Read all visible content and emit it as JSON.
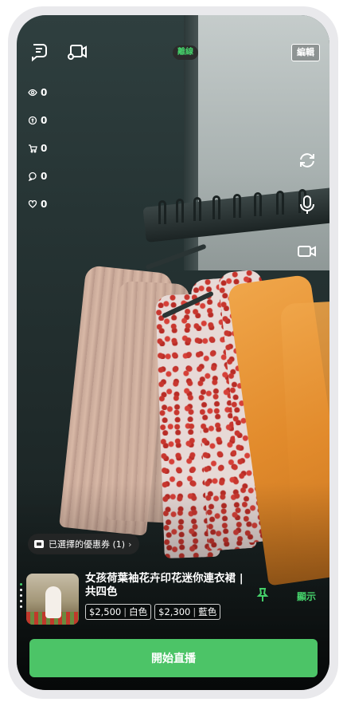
{
  "top_bar": {
    "live_badge": "離線",
    "edit_label": "編輯"
  },
  "stats": [
    {
      "icon": "eye-icon",
      "value": "0"
    },
    {
      "icon": "coin-icon",
      "value": "0"
    },
    {
      "icon": "cart-icon",
      "value": "0"
    },
    {
      "icon": "comment-icon",
      "value": "0"
    },
    {
      "icon": "heart-icon",
      "value": "0"
    }
  ],
  "coupon": {
    "label": "已選擇的優惠券 (1)",
    "chevron": "›"
  },
  "product": {
    "name": "女孩荷葉袖花卉印花迷你連衣裙 | 共四色",
    "prices": [
      {
        "price": "$2,500",
        "color": "白色"
      },
      {
        "price": "$2,300",
        "color": "藍色"
      }
    ],
    "show_label": "顯示"
  },
  "start_button": "開始直播",
  "colors": {
    "accent": "#4cc467",
    "live_text": "#45d06a"
  }
}
